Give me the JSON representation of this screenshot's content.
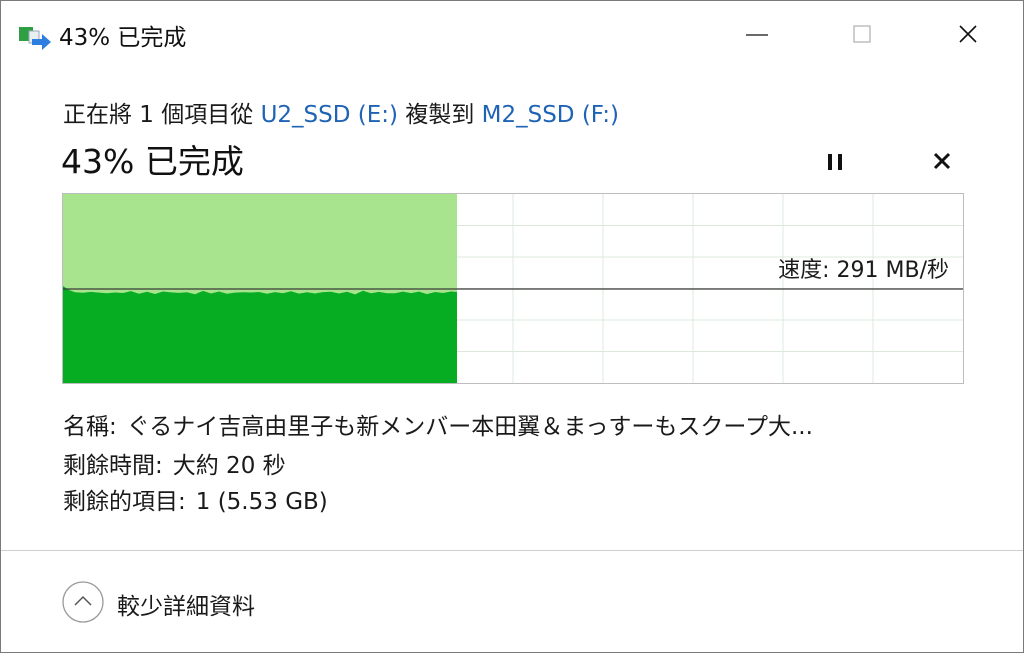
{
  "window": {
    "title": "43% 已完成",
    "icon": "copy-file-icon",
    "controls": [
      "minimize-icon",
      "maximize-icon",
      "close-icon"
    ]
  },
  "copy": {
    "prefix": "正在將 1 個項目從",
    "source": "U2_SSD (E:)",
    "middle": "複製到",
    "destination": "M2_SSD (F:)"
  },
  "progress": {
    "percent_text": "43% 已完成",
    "fraction": 0.43,
    "speed_text": "速度: 291 MB/秒"
  },
  "details": {
    "name_label": "名稱:",
    "name_value": "ぐるナイ吉高由里子も新メンバー本田翼＆まっすーもスクープ大...",
    "time_label": "剩餘時間:",
    "time_value": "大約 20 秒",
    "items_label": "剩餘的項目:",
    "items_value": "1 (5.53 GB)"
  },
  "footer": {
    "toggle_label": "較少詳細資料",
    "toggle_icon": "chevron-up-icon"
  },
  "colors": {
    "fill_light": "#a8e48e",
    "fill_dark": "#06ad23",
    "link": "#1f63b5",
    "grid": "#dde8dc"
  }
}
